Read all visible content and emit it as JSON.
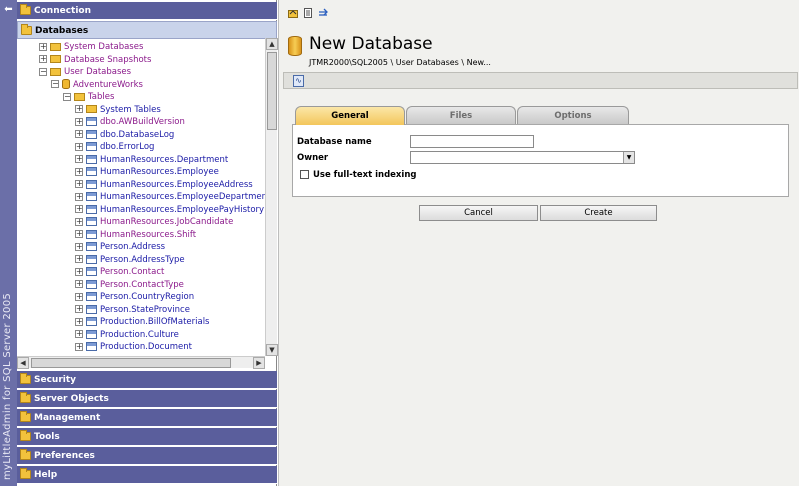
{
  "brand": {
    "text": "myLittleAdmin for SQL Server 2005"
  },
  "left_nav": {
    "sections_top": [
      {
        "label": "Connection"
      },
      {
        "label": "Databases"
      }
    ],
    "tree": [
      {
        "label": "System Databases",
        "color": "#8b1a8b",
        "icon": "folder-icon",
        "toggle": "+"
      },
      {
        "label": "Database Snapshots",
        "color": "#8b1a8b",
        "icon": "folder-icon",
        "toggle": "+"
      },
      {
        "label": "User Databases",
        "color": "#8b1a8b",
        "icon": "folder-icon",
        "toggle": "−"
      },
      {
        "label": "AdventureWorks",
        "color": "#8b1a8b",
        "icon": "database-icon",
        "toggle": "−"
      },
      {
        "label": "Tables",
        "color": "#8b1a8b",
        "icon": "folder-icon",
        "toggle": "−"
      },
      {
        "label": "System Tables",
        "color": "#1a1aa6",
        "icon": "folder-icon",
        "toggle": "+"
      },
      {
        "label": "dbo.AWBuildVersion",
        "color": "#8b1a8b",
        "icon": "table-icon",
        "toggle": "+"
      },
      {
        "label": "dbo.DatabaseLog",
        "color": "#1a1aa6",
        "icon": "table-icon",
        "toggle": "+"
      },
      {
        "label": "dbo.ErrorLog",
        "color": "#1a1aa6",
        "icon": "table-icon",
        "toggle": "+"
      },
      {
        "label": "HumanResources.Department",
        "color": "#1a1aa6",
        "icon": "table-icon",
        "toggle": "+"
      },
      {
        "label": "HumanResources.Employee",
        "color": "#1a1aa6",
        "icon": "table-icon",
        "toggle": "+"
      },
      {
        "label": "HumanResources.EmployeeAddress",
        "color": "#1a1aa6",
        "icon": "table-icon",
        "toggle": "+"
      },
      {
        "label": "HumanResources.EmployeeDepartmentHistory",
        "color": "#1a1aa6",
        "icon": "table-icon",
        "toggle": "+"
      },
      {
        "label": "HumanResources.EmployeePayHistory",
        "color": "#1a1aa6",
        "icon": "table-icon",
        "toggle": "+"
      },
      {
        "label": "HumanResources.JobCandidate",
        "color": "#8b1a8b",
        "icon": "table-icon",
        "toggle": "+"
      },
      {
        "label": "HumanResources.Shift",
        "color": "#8b1a8b",
        "icon": "table-icon",
        "toggle": "+"
      },
      {
        "label": "Person.Address",
        "color": "#1a1aa6",
        "icon": "table-icon",
        "toggle": "+"
      },
      {
        "label": "Person.AddressType",
        "color": "#1a1aa6",
        "icon": "table-icon",
        "toggle": "+"
      },
      {
        "label": "Person.Contact",
        "color": "#8b1a8b",
        "icon": "table-icon",
        "toggle": "+"
      },
      {
        "label": "Person.ContactType",
        "color": "#8b1a8b",
        "icon": "table-icon",
        "toggle": "+"
      },
      {
        "label": "Person.CountryRegion",
        "color": "#1a1aa6",
        "icon": "table-icon",
        "toggle": "+"
      },
      {
        "label": "Person.StateProvince",
        "color": "#1a1aa6",
        "icon": "table-icon",
        "toggle": "+"
      },
      {
        "label": "Production.BillOfMaterials",
        "color": "#1a1aa6",
        "icon": "table-icon",
        "toggle": "+"
      },
      {
        "label": "Production.Culture",
        "color": "#1a1aa6",
        "icon": "table-icon",
        "toggle": "+"
      },
      {
        "label": "Production.Document",
        "color": "#1a1aa6",
        "icon": "table-icon",
        "toggle": "+"
      }
    ],
    "sections_bottom": [
      {
        "label": "Security"
      },
      {
        "label": "Server Objects"
      },
      {
        "label": "Management"
      },
      {
        "label": "Tools"
      },
      {
        "label": "Preferences"
      },
      {
        "label": "Help"
      }
    ]
  },
  "main": {
    "toolbar_icons": [
      "open-folder-icon",
      "properties-icon",
      "refresh-icon"
    ],
    "title": "New Database",
    "breadcrumb": "JTMR2000\\SQL2005 \\ User Databases \\ New...",
    "tabs": [
      {
        "label": "General",
        "active": true
      },
      {
        "label": "Files",
        "active": false
      },
      {
        "label": "Options",
        "active": false
      }
    ],
    "form": {
      "database_name_label": "Database name",
      "database_name_value": "",
      "owner_label": "Owner",
      "owner_value": "",
      "fulltext_label": "Use full-text indexing",
      "fulltext_checked": false
    },
    "buttons": {
      "cancel": "Cancel",
      "create": "Create"
    }
  },
  "colors": {
    "nav_header": "#5a5e9c",
    "nav_header_selected": "#c9d3ea",
    "tab_active": "#f3c65c",
    "brand_strip": "#6b6fa8"
  }
}
